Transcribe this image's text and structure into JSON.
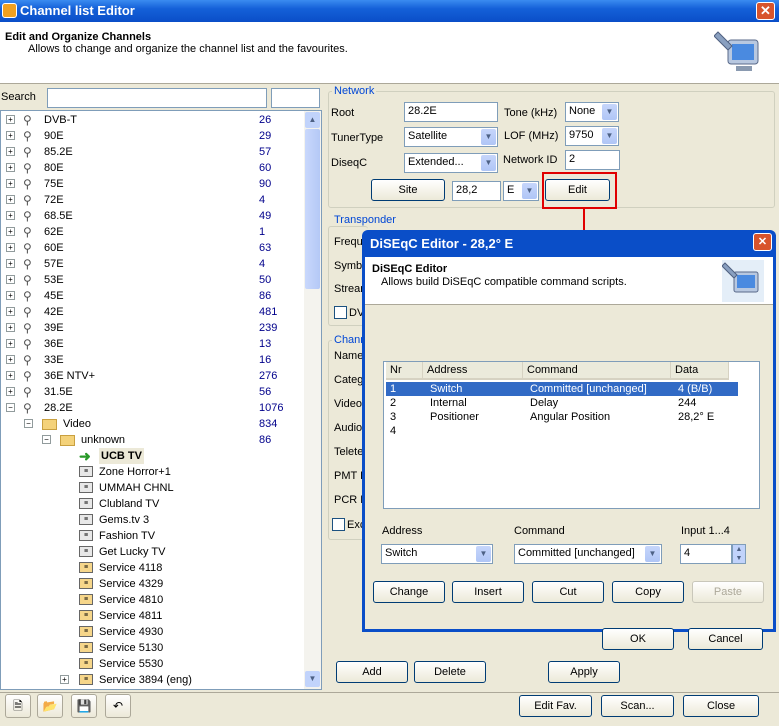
{
  "window": {
    "title": "Channel list Editor"
  },
  "header": {
    "title": "Edit and Organize Channels",
    "subtitle": "Allows to change and organize the channel list and the favourites."
  },
  "search": {
    "label": "Search",
    "value": "",
    "filter": ""
  },
  "tree": {
    "sats": [
      {
        "name": "DVB-T",
        "count": "26"
      },
      {
        "name": "90E",
        "count": "29"
      },
      {
        "name": "85.2E",
        "count": "57"
      },
      {
        "name": "80E",
        "count": "60"
      },
      {
        "name": "75E",
        "count": "90"
      },
      {
        "name": "72E",
        "count": "4"
      },
      {
        "name": "68.5E",
        "count": "49"
      },
      {
        "name": "62E",
        "count": "1"
      },
      {
        "name": "60E",
        "count": "63"
      },
      {
        "name": "57E",
        "count": "4"
      },
      {
        "name": "53E",
        "count": "50"
      },
      {
        "name": "45E",
        "count": "86"
      },
      {
        "name": "42E",
        "count": "481"
      },
      {
        "name": "39E",
        "count": "239"
      },
      {
        "name": "36E",
        "count": "13"
      },
      {
        "name": "33E",
        "count": "16"
      },
      {
        "name": "36E NTV+",
        "count": "276"
      },
      {
        "name": "31.5E",
        "count": "56"
      },
      {
        "name": "28.2E",
        "count": "1076"
      }
    ],
    "folder_video": {
      "name": "Video",
      "count": "834"
    },
    "folder_unknown": {
      "name": "unknown",
      "count": "86"
    },
    "channels": [
      "UCB TV",
      "Zone Horror+1",
      "UMMAH CHNL",
      "Clubland TV",
      "Gems.tv 3",
      "Fashion TV",
      "Get Lucky TV",
      "Service 4118",
      "Service 4329",
      "Service 4810",
      "Service 4811",
      "Service 4930",
      "Service 5130",
      "Service 5530",
      "Service 3894 (eng)"
    ]
  },
  "network": {
    "group_label": "Network",
    "root_label": "Root",
    "root_value": "28.2E",
    "tone_label": "Tone (kHz)",
    "tone_value": "None",
    "tunertype_label": "TunerType",
    "tunertype_value": "Satellite",
    "lof_label": "LOF (MHz)",
    "lof_value": "9750",
    "diseqc_label": "DiseqC",
    "diseqc_value": "Extended...",
    "netid_label": "Network ID",
    "netid_value": "2",
    "site_btn": "Site",
    "pos_value": "28,2",
    "dir_value": "E",
    "edit_btn": "Edit"
  },
  "transponder": {
    "group_label": "Transponder",
    "freq_label": "Frequ",
    "symb_label": "Symbo",
    "stream_label": "Strear",
    "dvb_label": "DV"
  },
  "channel": {
    "group_label": "Chann",
    "name_label": "Name",
    "cat_label": "Categ",
    "video_label": "Video",
    "audio_label": "Audio",
    "telet_label": "Telete",
    "pmt_label": "PMT P",
    "pcr_label": "PCR P",
    "exc_label": "Exc"
  },
  "bottom": {
    "add": "Add",
    "delete": "Delete",
    "apply": "Apply",
    "edit_fav": "Edit Fav.",
    "scan": "Scan...",
    "close": "Close"
  },
  "dialog": {
    "title": "DiSEqC Editor - 28,2° E",
    "header_title": "DiSEqC Editor",
    "header_sub": "Allows build DiSEqC compatible command scripts.",
    "columns": [
      "Nr",
      "Address",
      "Command",
      "Data"
    ],
    "rows": [
      {
        "nr": "1",
        "address": "Switch",
        "command": "Committed [unchanged]",
        "data": "4  (B/B)"
      },
      {
        "nr": "2",
        "address": "Internal",
        "command": "Delay",
        "data": "244"
      },
      {
        "nr": "3",
        "address": "Positioner",
        "command": "Angular Position",
        "data": "28,2° E"
      },
      {
        "nr": "4",
        "address": "",
        "command": "",
        "data": ""
      }
    ],
    "address_label": "Address",
    "address_value": "Switch",
    "command_label": "Command",
    "command_value": "Committed [unchanged]",
    "input_label": "Input 1...4",
    "input_value": "4",
    "change": "Change",
    "insert": "Insert",
    "cut": "Cut",
    "copy": "Copy",
    "paste": "Paste",
    "ok": "OK",
    "cancel": "Cancel"
  },
  "colors": {
    "highlight": "#316ac5",
    "annotation": "#e00000",
    "title_blue": "#0a4ec8"
  }
}
